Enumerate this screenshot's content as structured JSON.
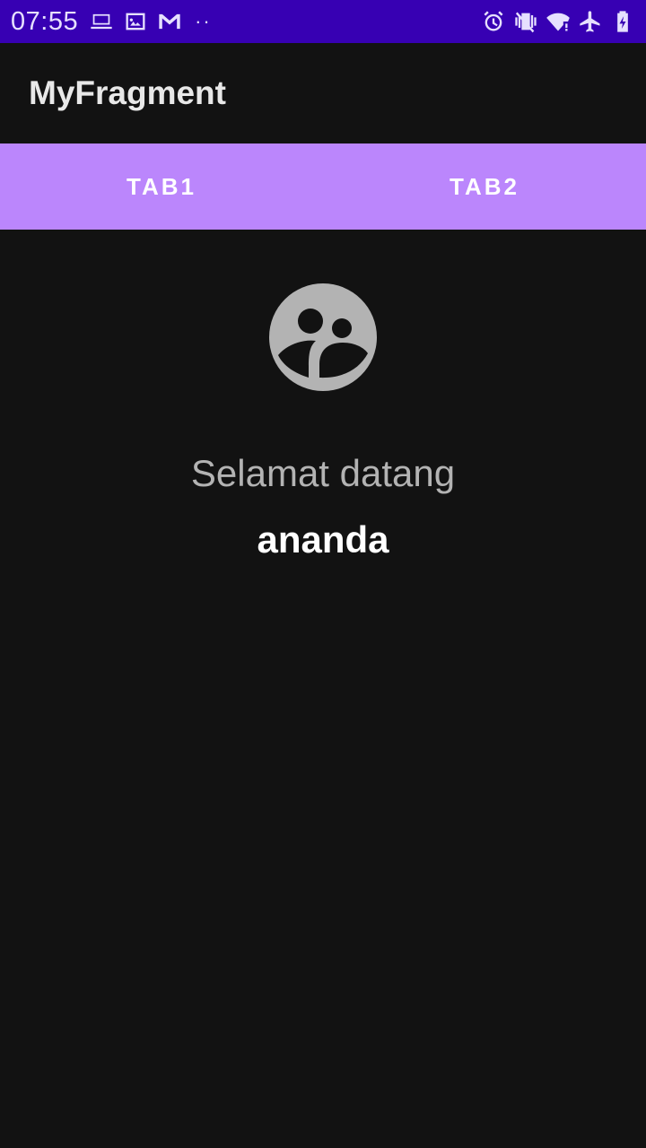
{
  "status_bar": {
    "time": "07:55",
    "left_icons": [
      "laptop-icon",
      "image-icon",
      "gmail-icon"
    ],
    "overflow": "··",
    "right_icons": [
      "alarm-icon",
      "vibrate-icon",
      "wifi-icon",
      "airplane-mode-icon",
      "battery-charging-icon"
    ]
  },
  "app_bar": {
    "title": "MyFragment"
  },
  "tabs": [
    {
      "label": "TAB1"
    },
    {
      "label": "TAB2"
    }
  ],
  "content": {
    "icon": "group-avatar-icon",
    "welcome": "Selamat datang",
    "name": "ananda"
  },
  "colors": {
    "status_bar": "#3700b3",
    "tab_bar": "#bb86fc",
    "background": "#121212",
    "icon": "#b3b3b3"
  }
}
